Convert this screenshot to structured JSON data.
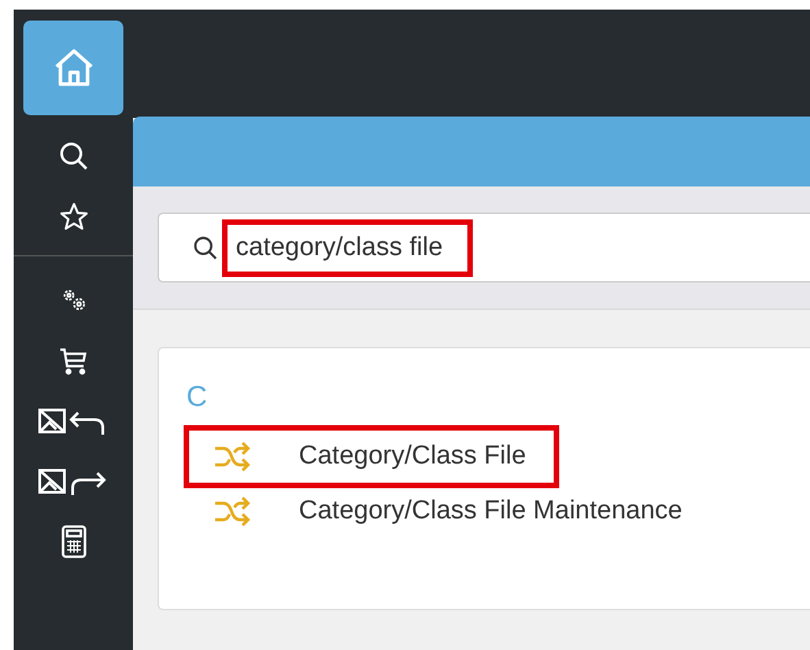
{
  "sidebar": {
    "groups": [
      [
        {
          "kind": "home",
          "selected": true
        },
        {
          "kind": "search",
          "selected": false
        },
        {
          "kind": "star",
          "selected": false
        }
      ],
      [
        {
          "kind": "gears",
          "selected": false
        },
        {
          "kind": "cart",
          "selected": false
        },
        {
          "kind": "image-back",
          "selected": false
        },
        {
          "kind": "image-forward",
          "selected": false
        },
        {
          "kind": "calculator",
          "selected": false
        }
      ]
    ]
  },
  "search": {
    "value": "category/class file",
    "highlighted": true
  },
  "results": {
    "group": "C",
    "items": [
      {
        "label": "Category/Class File",
        "highlighted": true
      },
      {
        "label": "Category/Class File Maintenance",
        "highlighted": false
      }
    ]
  }
}
